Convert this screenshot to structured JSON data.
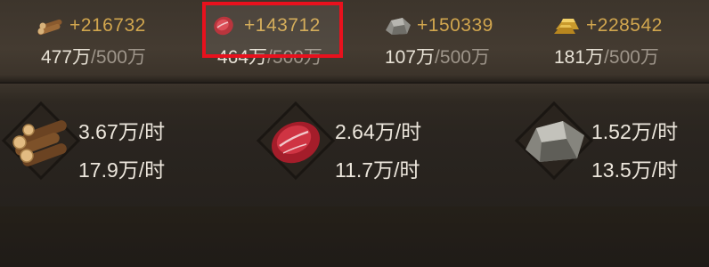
{
  "resources": [
    {
      "name": "wood",
      "icon": "wood-icon",
      "gain": "+216732",
      "current": "477万",
      "max": "500万"
    },
    {
      "name": "meat",
      "icon": "meat-icon",
      "gain": "+143712",
      "current": "464万",
      "max": "500万"
    },
    {
      "name": "stone",
      "icon": "stone-icon",
      "gain": "+150339",
      "current": "107万",
      "max": "500万"
    },
    {
      "name": "gold",
      "icon": "gold-icon",
      "gain": "+228542",
      "current": "181万",
      "max": "500万"
    }
  ],
  "production": [
    {
      "name": "wood",
      "icon": "wood-icon",
      "rate": "3.67万/时",
      "second": "17.9万/时"
    },
    {
      "name": "meat",
      "icon": "meat-icon",
      "rate": "2.64万/时",
      "second": "11.7万/时"
    },
    {
      "name": "stone",
      "icon": "stone-icon",
      "rate": "1.52万/时",
      "second": "13.5万/时"
    }
  ],
  "colors": {
    "highlight": "#e8111d",
    "gain": "#d1a64e",
    "text": "#e8e2d6",
    "muted": "#9e958a"
  }
}
